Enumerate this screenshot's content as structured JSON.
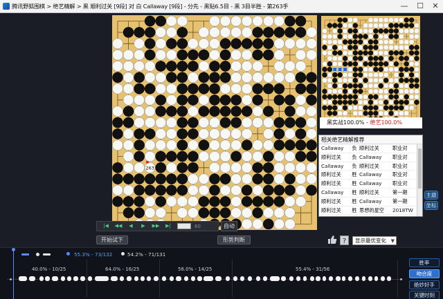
{
  "window": {
    "title": "腾讯野狐围棋 > 绝艺精解 > 黑 顺利过关 [9段] 对 白 Callaway [9段] - 分先 - 黑贴6.5目 - 黑 3目半胜 - 第263手",
    "minimize_glyph": "—",
    "maximize_glyph": "☐",
    "close_glyph": "✕"
  },
  "board": {
    "size": 19,
    "last_move_label": "263",
    "rows": [
      "...XXOO..OOOOOOOXX.",
      ".XXXOOX.OOOOOXXXXXO",
      "O.OXOXXOOOXXXXXOOOO",
      "OOOXOOXXXOXOOXXO.OO",
      "OOOOXXXXOXXOOO.OOO.",
      "XOXOOXXOXXXOOOOOOXX",
      "OOXXOOXXXXOOOXXX.XX",
      ".OOOXOXXOXXXOX.XXOX",
      "OXOOXXXOXXXXXOX.XOO",
      "XXOOOOXXOOXXOOOXXXO",
      "XOXXOOXXOOOOO.OXOXO",
      "OOXOOOXOXOOOXOOXXXX",
      ".OXOXXXXOOOXOOXOOXX",
      "XOOOXOXX.OOOOXXOOOO",
      "XXXXXXXOOXXOOXXOXOO",
      "OOXXXXXOOXOOXOXXXOX",
      "XXXOXOOOXXXOXXXXOO.",
      ".XXOO.OOXXXOOXOOO..",
      "..OOO...OXXXOOXOO.."
    ]
  },
  "mini_board": {
    "caption_main": "黑实战100.0% - ",
    "caption_ai": "绝艺100.0%",
    "blue_marks": [
      [
        9,
        2
      ],
      [
        9,
        3
      ],
      [
        9,
        4
      ]
    ]
  },
  "recommend": {
    "header": "相关绝艺精解推荐",
    "rows": [
      {
        "a": "Callaway",
        "r": "负",
        "b": "顺利过关",
        "t": "职业对"
      },
      {
        "a": "顺利过关",
        "r": "负",
        "b": "Callaway",
        "t": "职业对"
      },
      {
        "a": "Callaway",
        "r": "负",
        "b": "顺利过关",
        "t": "职业对"
      },
      {
        "a": "顺利过关",
        "r": "胜",
        "b": "Callaway",
        "t": "职业对"
      },
      {
        "a": "顺利过关",
        "r": "胜",
        "b": "Callaway",
        "t": "职业对"
      },
      {
        "a": "Callaway",
        "r": "胜",
        "b": "顺利过关",
        "t": "第一期"
      },
      {
        "a": "顺利过关",
        "r": "胜",
        "b": "Callaway",
        "t": "第一期"
      },
      {
        "a": "顺利过关",
        "r": "胜",
        "b": "思想的星空",
        "t": "2018TW"
      }
    ]
  },
  "side_buttons": {
    "main": "主题",
    "coord": "坐标"
  },
  "nav": {
    "buttons": [
      "|◀",
      "◀◀",
      "◀",
      "▶",
      "▶▶",
      "▶|"
    ],
    "move_count": "60",
    "auto": "自动"
  },
  "actions": {
    "trial": "开始试下",
    "judge": "形势判断",
    "best_change": "显示最优变化"
  },
  "analysis": {
    "legend": [
      {
        "text": "55.3% - 73/132",
        "color": "#5aa0ff"
      },
      {
        "text": "54.2% - 71/131",
        "color": "#d7d7d7"
      }
    ],
    "segments": [
      {
        "label": "40.0% - 10/25"
      },
      {
        "label": "64.0% - 16/25"
      },
      {
        "label": "56.0% - 14/25"
      },
      {
        "label": "55.4% - 31/56"
      }
    ]
  },
  "right_buttons": {
    "winrate": "胜率",
    "match": "吻合度",
    "top_moves": "绝妙好手",
    "critical": "关键时刻"
  },
  "colors": {
    "board": "#e6c170",
    "accent_blue": "#5a8cff",
    "ai_red": "#d01818",
    "nav_green": "#49d07d"
  }
}
